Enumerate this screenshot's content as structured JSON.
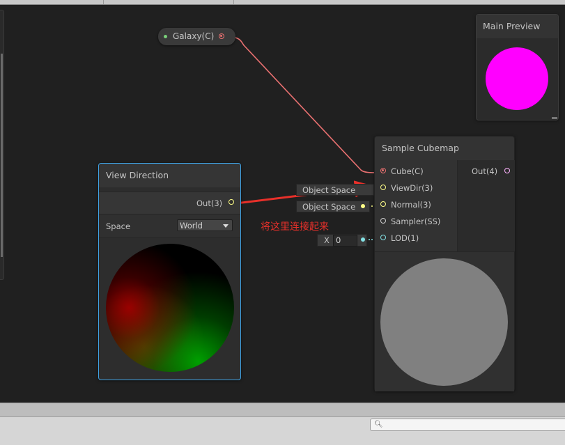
{
  "galaxy_node": {
    "label": "Galaxy(C)"
  },
  "main_preview": {
    "title": "Main Preview",
    "color": "#ff00ff"
  },
  "view_direction": {
    "title": "View Direction",
    "output_label": "Out(3)",
    "space_label": "Space",
    "space_value": "World"
  },
  "sample_cubemap": {
    "title": "Sample Cubemap",
    "inputs": [
      "Cube(C)",
      "ViewDir(3)",
      "Normal(3)",
      "Sampler(SS)",
      "LOD(1)"
    ],
    "output_label": "Out(4)",
    "inline_viewdir": "Object Space",
    "inline_normal": "Object Space",
    "lod_axis": "X",
    "lod_value": "0"
  },
  "annotation": {
    "text": "将这里连接起来",
    "color": "#e8302a"
  },
  "colors": {
    "cube_wire": "#e87070",
    "vector3_port": "#ffff88",
    "vector1_port": "#84e4e7"
  }
}
